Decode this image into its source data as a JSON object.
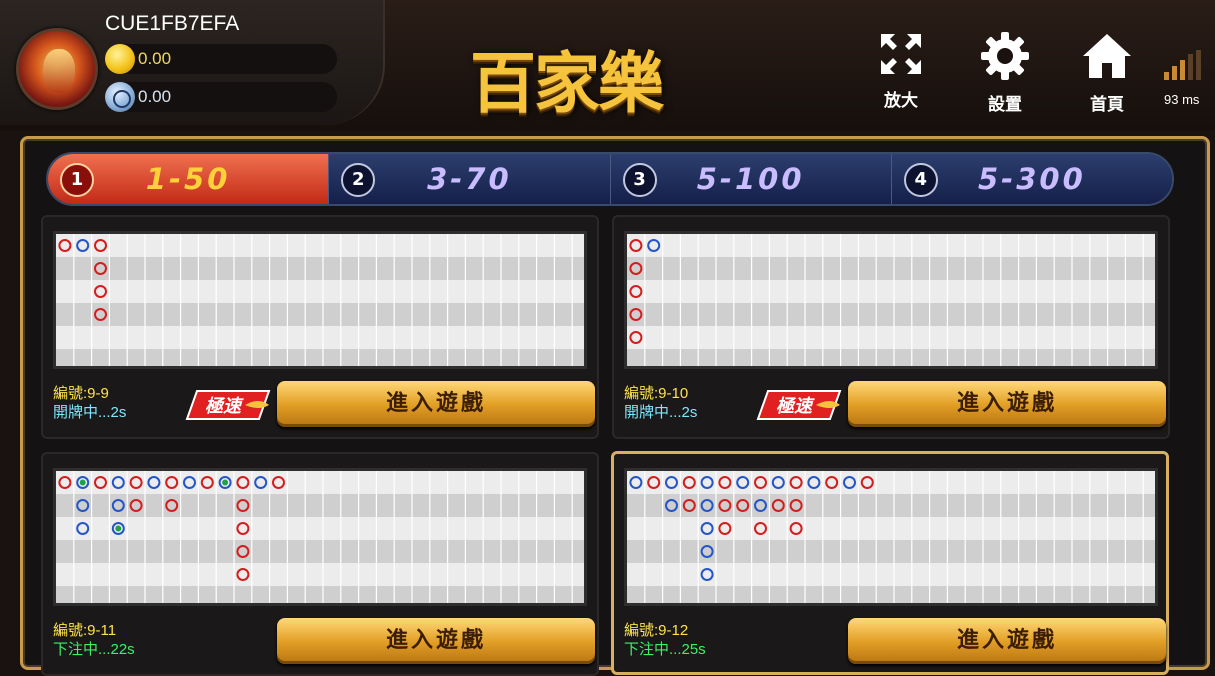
{
  "player": {
    "username": "CUE1FB7EFA",
    "gold_balance": "0.00",
    "silver_balance": "0.00"
  },
  "logo_text": "百家樂",
  "top_buttons": {
    "zoom": "放大",
    "settings": "設置",
    "home": "首頁"
  },
  "latency": "93 ms",
  "colors": {
    "banker": "#d41e1e",
    "player": "#2456c8",
    "tie": "#1fa34a",
    "gold": "#f5c43c"
  },
  "tabs": [
    {
      "num": "1",
      "range": "1-50",
      "active": true
    },
    {
      "num": "2",
      "range": "3-70",
      "active": false
    },
    {
      "num": "3",
      "range": "5-100",
      "active": false
    },
    {
      "num": "4",
      "range": "5-300",
      "active": false
    }
  ],
  "tables": [
    {
      "id": "編號:9-9",
      "status": "開牌中...2s",
      "status_color": "#7fe6ff",
      "speed_badge": "極速",
      "enter_label": "進入遊戲",
      "selected": false,
      "road": [
        [
          {
            "c": "B",
            "r": 0
          },
          {
            "c": "B",
            "r": 1
          },
          {
            "c": "B",
            "r": 2
          },
          {
            "c": "B",
            "r": 3
          }
        ]
      ],
      "road_raw": [
        [
          0,
          0,
          "B"
        ],
        [
          1,
          0,
          "P"
        ],
        [
          2,
          0,
          "B"
        ],
        [
          2,
          1,
          "B"
        ],
        [
          2,
          2,
          "B"
        ],
        [
          2,
          3,
          "B"
        ]
      ]
    },
    {
      "id": "編號:9-10",
      "status": "開牌中...2s",
      "status_color": "#7fe6ff",
      "speed_badge": "極速",
      "enter_label": "進入遊戲",
      "selected": false,
      "road_raw": [
        [
          0,
          0,
          "B"
        ],
        [
          1,
          0,
          "P"
        ],
        [
          0,
          1,
          "B"
        ],
        [
          0,
          2,
          "B"
        ],
        [
          0,
          3,
          "B"
        ],
        [
          0,
          4,
          "B"
        ]
      ]
    },
    {
      "id": "編號:9-11",
      "status": "下注中...22s",
      "status_color": "#3cf06a",
      "speed_badge": "",
      "enter_label": "進入遊戲",
      "selected": false,
      "road_raw": [
        [
          0,
          0,
          "B"
        ],
        [
          1,
          0,
          "PT"
        ],
        [
          2,
          0,
          "B"
        ],
        [
          3,
          0,
          "P"
        ],
        [
          4,
          0,
          "B"
        ],
        [
          5,
          0,
          "P"
        ],
        [
          6,
          0,
          "B"
        ],
        [
          7,
          0,
          "P"
        ],
        [
          8,
          0,
          "B"
        ],
        [
          9,
          0,
          "PT"
        ],
        [
          10,
          0,
          "B"
        ],
        [
          11,
          0,
          "P"
        ],
        [
          12,
          0,
          "B"
        ],
        [
          1,
          1,
          "P"
        ],
        [
          3,
          1,
          "P"
        ],
        [
          4,
          1,
          "B"
        ],
        [
          6,
          1,
          "B"
        ],
        [
          10,
          1,
          "B"
        ],
        [
          1,
          2,
          "P"
        ],
        [
          3,
          2,
          "PT"
        ],
        [
          10,
          2,
          "B"
        ],
        [
          10,
          3,
          "B"
        ],
        [
          10,
          4,
          "B"
        ]
      ]
    },
    {
      "id": "編號:9-12",
      "status": "下注中...25s",
      "status_color": "#3cf06a",
      "speed_badge": "",
      "enter_label": "進入遊戲",
      "selected": true,
      "road_raw": [
        [
          0,
          0,
          "P"
        ],
        [
          1,
          0,
          "B"
        ],
        [
          2,
          0,
          "P"
        ],
        [
          3,
          0,
          "B"
        ],
        [
          4,
          0,
          "P"
        ],
        [
          5,
          0,
          "B"
        ],
        [
          6,
          0,
          "P"
        ],
        [
          7,
          0,
          "B"
        ],
        [
          8,
          0,
          "P"
        ],
        [
          9,
          0,
          "B"
        ],
        [
          10,
          0,
          "P"
        ],
        [
          11,
          0,
          "B"
        ],
        [
          12,
          0,
          "P"
        ],
        [
          13,
          0,
          "B"
        ],
        [
          2,
          1,
          "P"
        ],
        [
          3,
          1,
          "B"
        ],
        [
          4,
          1,
          "P"
        ],
        [
          5,
          1,
          "B"
        ],
        [
          6,
          1,
          "B"
        ],
        [
          7,
          1,
          "P"
        ],
        [
          8,
          1,
          "B"
        ],
        [
          9,
          1,
          "B"
        ],
        [
          4,
          2,
          "P"
        ],
        [
          5,
          2,
          "B"
        ],
        [
          7,
          2,
          "B"
        ],
        [
          9,
          2,
          "B"
        ],
        [
          4,
          3,
          "P"
        ],
        [
          4,
          4,
          "P"
        ]
      ]
    }
  ]
}
